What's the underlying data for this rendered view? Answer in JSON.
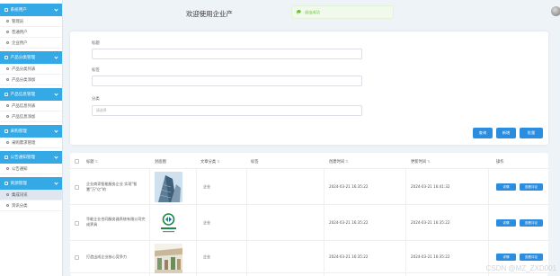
{
  "sidebar": {
    "groups": [
      {
        "title": "系统用户",
        "items": [
          "管理员",
          "普通用户",
          "企业用户"
        ]
      },
      {
        "title": "产品分类管理",
        "items": [
          "产品分类列表",
          "产品分类添加"
        ]
      },
      {
        "title": "产品信息管理",
        "items": [
          "产品信息列表",
          "产品信息添加"
        ]
      },
      {
        "title": "采购管理",
        "items": [
          "采购需求管理"
        ]
      },
      {
        "title": "公告通知管理",
        "items": [
          "公告通知"
        ]
      },
      {
        "title": "资源管理",
        "items": [
          "集成讯讯",
          "资讯分类"
        ]
      }
    ],
    "active_item": "集成讯讯"
  },
  "header": {
    "welcome": "欢迎使用企业产",
    "toast": "退出成功"
  },
  "search": {
    "label1": "标题",
    "label2": "标签",
    "label3": "分类",
    "placeholder3": "请选择",
    "btn_search": "查询",
    "btn_add": "新增",
    "btn_delete": "批量"
  },
  "table": {
    "headers": {
      "title": "标题",
      "cover": "封面图",
      "category": "文章分类",
      "tags": "标签",
      "created": "创建时间",
      "updated": "更新时间",
      "actions": "操作"
    },
    "rows": [
      {
        "title": "企业商家智能服务企业 实现\"智慧\"万\"亿\"的",
        "category": "企业",
        "tags": "",
        "created": "2024-03-21 16:35:22",
        "updated": "2024-03-21 16:41:32",
        "btn_detail": "详情",
        "btn_edit": "查看评论"
      },
      {
        "title": "华能企业合同服务器系统有限公司完成界具",
        "category": "企业",
        "tags": "",
        "created": "2024-03-21 16:35:22",
        "updated": "2024-03-21 16:35:22",
        "btn_detail": "详情",
        "btn_edit": "查看评论"
      },
      {
        "title": "打造出成企业核心竞争力",
        "category": "企业",
        "tags": "",
        "created": "2024-03-21 16:35:22",
        "updated": "2024-03-21 16:35:22",
        "btn_detail": "详情",
        "btn_edit": "查看评论"
      }
    ]
  },
  "watermark": "CSDN @MZ_ZXD001",
  "colors": {
    "primary": "#2a8de0",
    "sidebar_header": "#35a8e6",
    "success": "#67c23a"
  }
}
